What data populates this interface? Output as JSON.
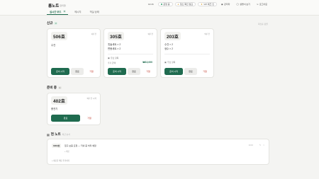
{
  "app": {
    "brand": "룸노트",
    "brand_sub": "v 관리형"
  },
  "tabs": [
    {
      "label": "실시간 보드",
      "count": "3"
    },
    {
      "label": "메시지"
    },
    {
      "label": "객실 상태"
    }
  ],
  "topnav": {
    "time": "14:16",
    "status": "운영 중",
    "alert": "청소 확인 필요",
    "alert2": "VIP 체크 인",
    "settings": "관리자",
    "help": "설명서 보기",
    "logout": "로그아웃"
  },
  "sections": {
    "new": {
      "title": "신규",
      "count": "3",
      "right": "최신순 정렬"
    },
    "ready": {
      "title": "준비 중",
      "count": "1"
    },
    "notes": {
      "title": "현 노트",
      "right": "최근 순서"
    }
  },
  "new_cards": [
    {
      "room": "506호",
      "elapsed": "1분 전",
      "items": [
        "수건"
      ],
      "buttons": [
        "준비 시작",
        "완료",
        "거절"
      ]
    },
    {
      "room": "305호",
      "elapsed": "3분 전",
      "items": [
        "칫솔세트 × 2",
        "면봉세트 × 2"
      ],
      "meta": "유료 항목",
      "cost_label": "추가 금액",
      "cost": "₩13,000",
      "buttons": [
        "준비 시작",
        "완료",
        "거절"
      ]
    },
    {
      "room": "203호",
      "elapsed": "5분 전",
      "items": [
        "수건 × 2",
        "생수 × 2"
      ],
      "meta": "무료 항목",
      "buttons": [
        "준비 시작",
        "완료",
        "거절"
      ]
    }
  ],
  "ready_cards": [
    {
      "room": "402호",
      "elapsed": "5분 전 시작",
      "items": [
        "충전기"
      ],
      "buttons": [
        "완료",
        "거절"
      ]
    }
  ],
  "note": {
    "tag": "1004호",
    "text": "침구 보충 요청 — 저녁 중 처리 예정",
    "time": "14:10",
    "sub": "+ 메모",
    "add": "+ 새로운 메모 추가하기"
  },
  "colors": {
    "accent": "#1f6b4f",
    "danger": "#c0392b"
  }
}
